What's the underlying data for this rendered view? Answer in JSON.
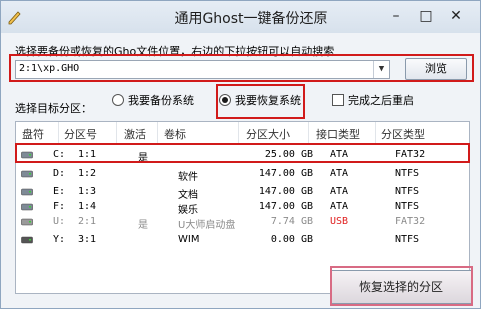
{
  "window": {
    "title": "通用Ghost一键备份还原"
  },
  "path": {
    "label": "选择要备份或恢复的Gho文件位置，右边的下拉按钮可以自动搜索",
    "value": "2:1\\xp.GHO",
    "browse_label": "浏览"
  },
  "options": {
    "partition_label": "选择目标分区：",
    "backup_label": "我要备份系统",
    "restore_label": "我要恢复系统",
    "restart_label": "完成之后重启",
    "selected": "restore"
  },
  "table": {
    "headers": [
      "盘符",
      "分区号",
      "激活",
      "卷标",
      "分区大小",
      "接口类型",
      "分区类型"
    ],
    "rows": [
      {
        "drive": "C:",
        "part": "1:1",
        "active": "是",
        "label": "",
        "size": "25.00 GB",
        "iface": "ATA",
        "fs": "FAT32",
        "icon": "hard-drive-icon"
      },
      {
        "drive": "D:",
        "part": "1:2",
        "active": "",
        "label": "软件",
        "size": "147.00 GB",
        "iface": "ATA",
        "fs": "NTFS",
        "icon": "hard-drive-icon"
      },
      {
        "drive": "E:",
        "part": "1:3",
        "active": "",
        "label": "文档",
        "size": "147.00 GB",
        "iface": "ATA",
        "fs": "NTFS",
        "icon": "hard-drive-icon"
      },
      {
        "drive": "F:",
        "part": "1:4",
        "active": "",
        "label": "娱乐",
        "size": "147.00 GB",
        "iface": "ATA",
        "fs": "NTFS",
        "icon": "hard-drive-icon"
      },
      {
        "drive": "U:",
        "part": "2:1",
        "active": "是",
        "label": "U大师启动盘",
        "size": "7.74 GB",
        "iface": "USB",
        "fs": "FAT32",
        "icon": "usb-drive-icon"
      },
      {
        "drive": "Y:",
        "part": "3:1",
        "active": "",
        "label": "WIM",
        "size": "0.00 GB",
        "iface": "",
        "fs": "NTFS",
        "icon": "virtual-drive-icon"
      }
    ]
  },
  "action": {
    "restore_button_label": "恢复选择的分区"
  },
  "colors": {
    "highlight_red": "#d11a1a",
    "usb_red": "#e02020"
  }
}
